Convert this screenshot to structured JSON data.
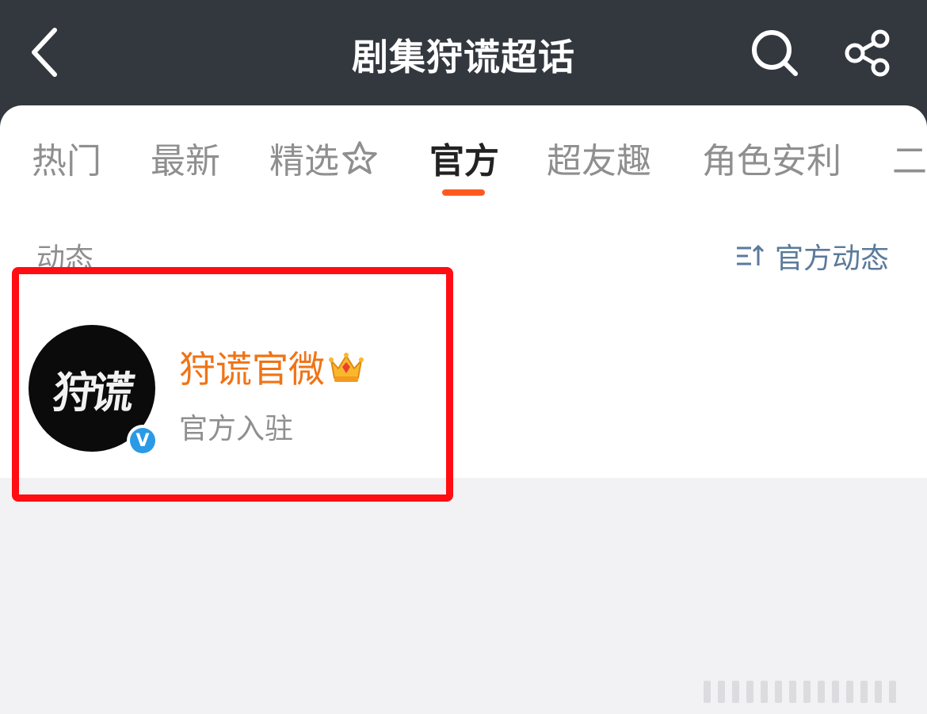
{
  "header": {
    "title": "剧集狩谎超话",
    "back_icon": "chevron-left-icon",
    "search_icon": "search-icon",
    "share_icon": "share-icon",
    "background": "#33383f"
  },
  "tabs": [
    {
      "label": "热门",
      "active": false
    },
    {
      "label": "最新",
      "active": false
    },
    {
      "label": "精选",
      "active": false
    },
    {
      "label": "官方",
      "active": true
    },
    {
      "label": "超友趣",
      "active": false
    },
    {
      "label": "角色安利",
      "active": false
    },
    {
      "label": "二",
      "active": false
    }
  ],
  "accent_color": "#ff5a1e",
  "section": {
    "label": "动态",
    "official_feed_label": "官方动态"
  },
  "account": {
    "avatar_text": "狩谎",
    "name": "狩谎官微",
    "subtitle": "官方入驻",
    "verified_badge": "V",
    "name_color": "#f07316"
  },
  "highlight_color": "#ff0d12"
}
